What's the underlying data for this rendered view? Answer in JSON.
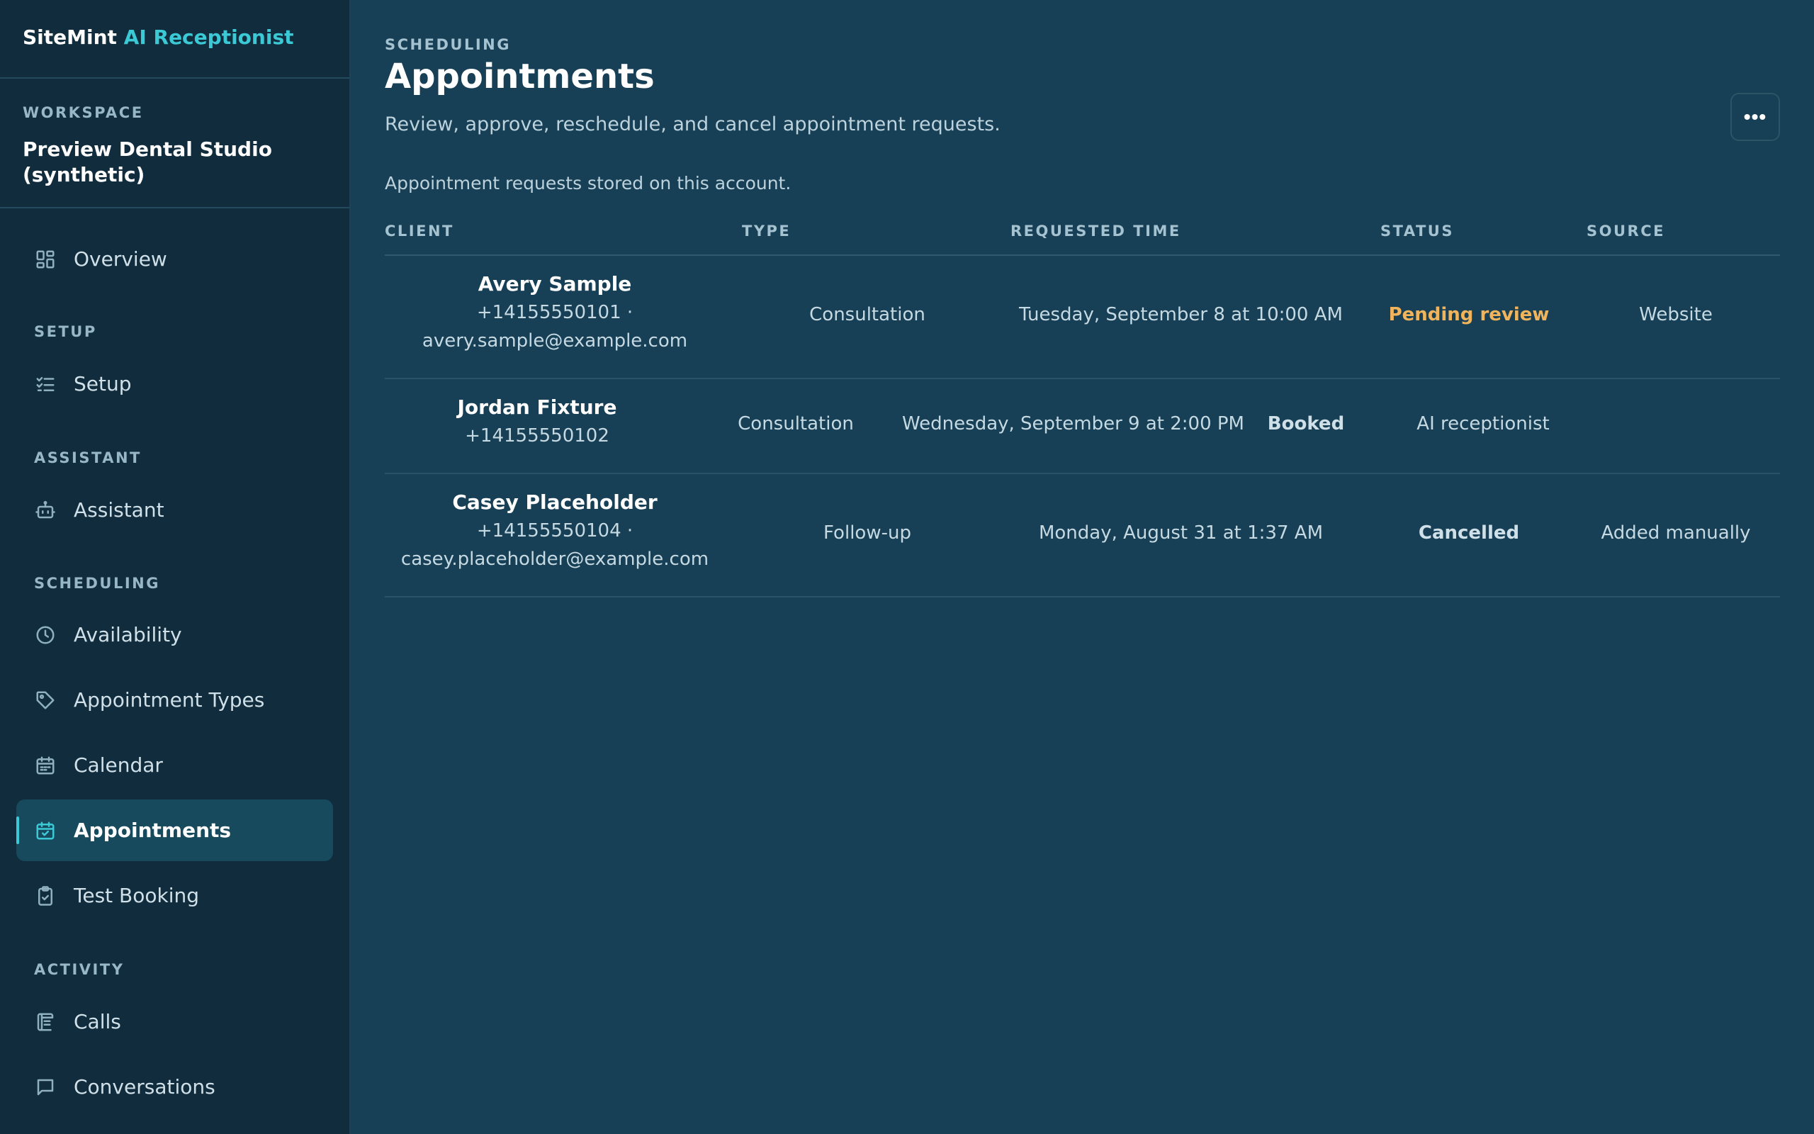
{
  "brand": {
    "name": "SiteMint",
    "product": "AI Receptionist"
  },
  "workspace": {
    "label": "WORKSPACE",
    "name": "Preview Dental Studio (synthetic)"
  },
  "nav": {
    "overview": "Overview",
    "sections": {
      "setup": "SETUP",
      "assistant": "ASSISTANT",
      "scheduling": "SCHEDULING",
      "activity": "ACTIVITY"
    },
    "items": {
      "setup": "Setup",
      "assistant": "Assistant",
      "availability": "Availability",
      "appointment_types": "Appointment Types",
      "calendar": "Calendar",
      "appointments": "Appointments",
      "test_booking": "Test Booking",
      "calls": "Calls",
      "conversations": "Conversations"
    }
  },
  "header": {
    "eyebrow": "SCHEDULING",
    "title": "Appointments",
    "subtitle": "Review, approve, reschedule, and cancel appointment requests.",
    "more_label": "•••"
  },
  "caption": "Appointment requests stored on this account.",
  "table": {
    "columns": [
      "CLIENT",
      "TYPE",
      "REQUESTED TIME",
      "STATUS",
      "SOURCE"
    ],
    "rows": [
      {
        "name": "Avery Sample",
        "contact_line1": "+14155550101 ·",
        "contact_line2": "avery.sample@example.com",
        "type": "Consultation",
        "time": "Tuesday, September 8 at 10:00 AM",
        "status": "Pending review",
        "source": "Website"
      },
      {
        "name": "Jordan Fixture",
        "contact_line1": "+14155550102",
        "contact_line2": "",
        "type": "Consultation",
        "time": "Wednesday, September 9 at 2:00 PM",
        "status": "Booked",
        "source": "AI receptionist"
      },
      {
        "name": "Casey Placeholder",
        "contact_line1": "+14155550104 ·",
        "contact_line2": "casey.placeholder@example.com",
        "type": "Follow-up",
        "time": "Monday, August 31 at 1:37 AM",
        "status": "Cancelled",
        "source": "Added manually"
      }
    ]
  },
  "colors": {
    "accent": "#3bc9d6",
    "sidebar_bg": "#112c3c",
    "main_bg": "#173f55",
    "pending": "#f0b45c"
  }
}
